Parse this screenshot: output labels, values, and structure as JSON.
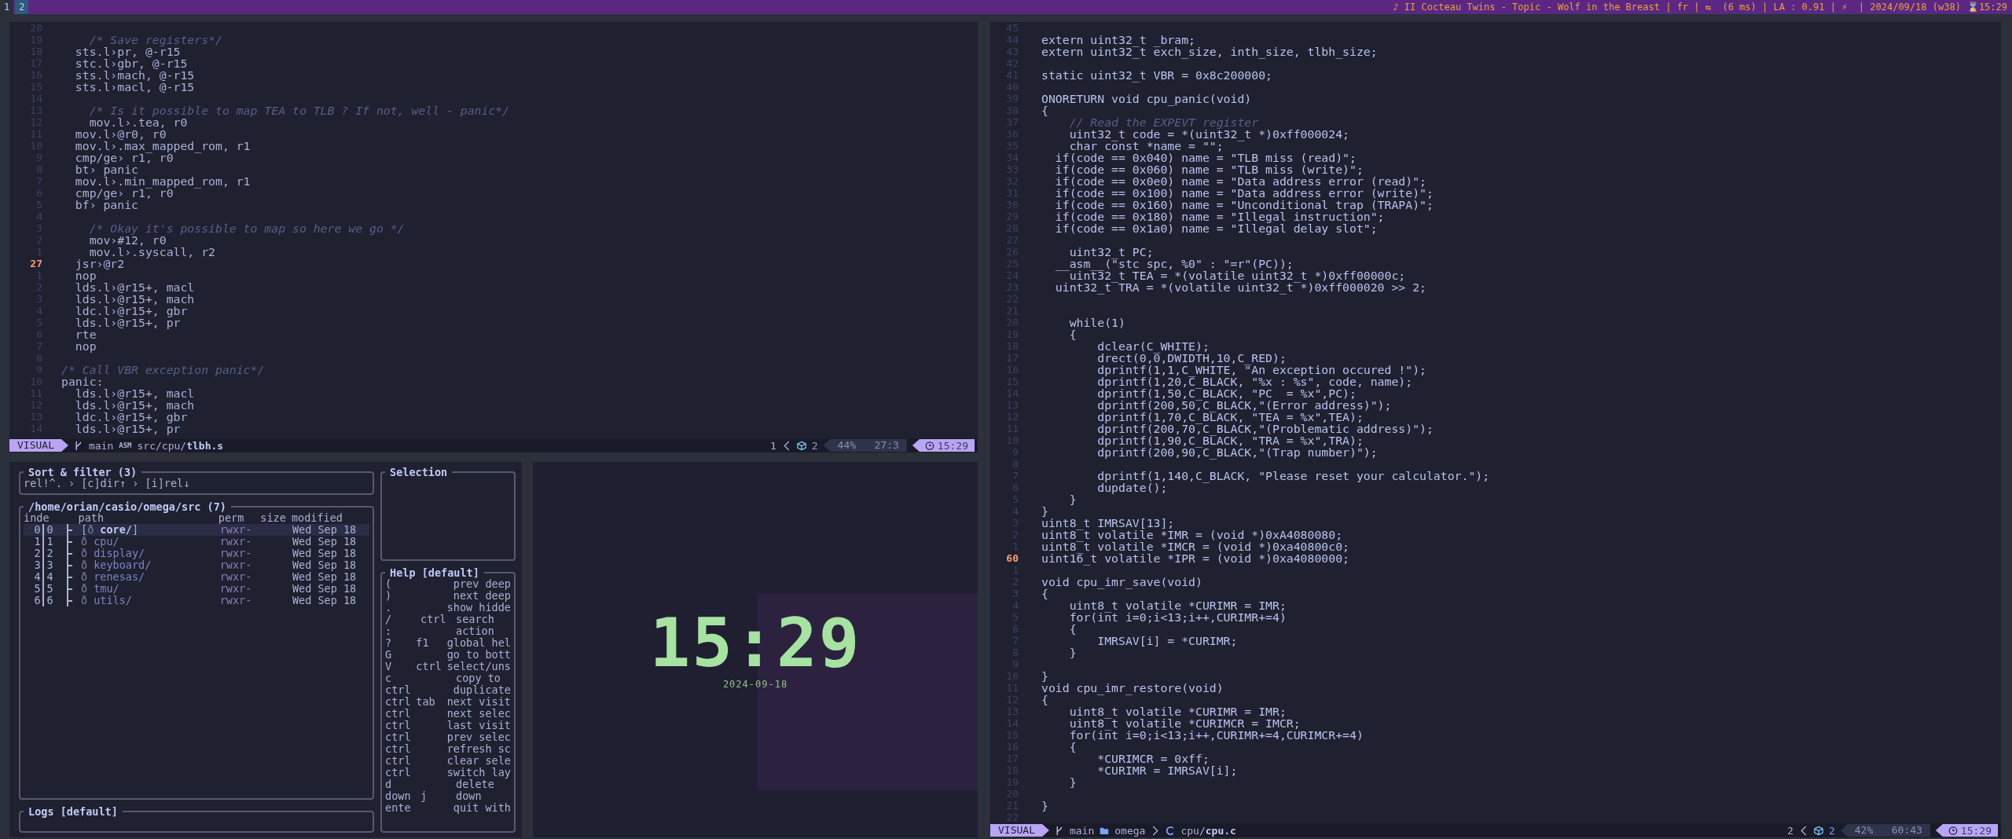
{
  "top_bar": {
    "workspaces": [
      {
        "label": "1",
        "selected": false
      },
      {
        "label": "2",
        "selected": true
      }
    ],
    "status": "♪ II Cocteau Twins - Topic - Wolf in the Breast | fr | ⇆  (6 ms) | LA : 0.91 | ⚡  | 2024/09/18 (w38)",
    "clock": "⌛15:29"
  },
  "left_editor": {
    "lines": [
      {
        "n": "20",
        "current": false
      },
      {
        "n": "19",
        "text": "    /* Save registers*/",
        "kind": "comment",
        "current": false
      },
      {
        "n": "18",
        "text": "  sts.l›pr, @-r15",
        "kind": "code",
        "current": false
      },
      {
        "n": "17",
        "text": "  stc.l›gbr, @-r15",
        "kind": "code",
        "current": false
      },
      {
        "n": "16",
        "text": "  sts.l›mach, @-r15",
        "kind": "code",
        "current": false
      },
      {
        "n": "15",
        "text": "  sts.l›macl, @-r15",
        "kind": "code",
        "current": false
      },
      {
        "n": "14",
        "current": false
      },
      {
        "n": "13",
        "text": "    /* Is it possible to map TEA to TLB ? If not, well - panic*/",
        "kind": "comment",
        "current": false
      },
      {
        "n": "12",
        "text": "    mov.l›.tea, r0",
        "kind": "code",
        "current": false
      },
      {
        "n": "11",
        "text": "  mov.l›@r0, r0",
        "kind": "code",
        "current": false
      },
      {
        "n": "10",
        "text": "  mov.l›.max_mapped_rom, r1",
        "kind": "code",
        "current": false
      },
      {
        "n": "9",
        "text": "  cmp/ge› r1, r0",
        "kind": "code",
        "current": false
      },
      {
        "n": "8",
        "text": "  bt› panic",
        "kind": "code",
        "current": false
      },
      {
        "n": "7",
        "text": "  mov.l›.min_mapped_rom, r1",
        "kind": "code",
        "current": false
      },
      {
        "n": "6",
        "text": "  cmp/ge› r1, r0",
        "kind": "code",
        "current": false
      },
      {
        "n": "5",
        "text": "  bf› panic",
        "kind": "code",
        "current": false
      },
      {
        "n": "4",
        "current": false
      },
      {
        "n": "3",
        "text": "    /* Okay it's possible to map so here we go */",
        "kind": "comment",
        "current": false
      },
      {
        "n": "2",
        "text": "    mov›#12, r0",
        "kind": "code",
        "current": false
      },
      {
        "n": "1",
        "text": "    mov.l›.syscall, r2",
        "kind": "code",
        "current": false
      },
      {
        "n": "27",
        "text": "  jsr›@r2",
        "kind": "code",
        "current": true
      },
      {
        "n": "1",
        "text": "  nop",
        "kind": "code",
        "current": false
      },
      {
        "n": "2",
        "text": "  lds.l›@r15+, macl",
        "kind": "code",
        "current": false
      },
      {
        "n": "3",
        "text": "  lds.l›@r15+, mach",
        "kind": "code",
        "current": false
      },
      {
        "n": "4",
        "text": "  ldc.l›@r15+, gbr",
        "kind": "code",
        "current": false
      },
      {
        "n": "5",
        "text": "  lds.l›@r15+, pr",
        "kind": "code",
        "current": false
      },
      {
        "n": "6",
        "text": "  rte",
        "kind": "code",
        "current": false
      },
      {
        "n": "7",
        "text": "  nop",
        "kind": "code",
        "current": false
      },
      {
        "n": "8",
        "current": false
      },
      {
        "n": "9",
        "text": "/* Call VBR exception panic*/",
        "kind": "comment",
        "current": false
      },
      {
        "n": "10",
        "text": "panic:",
        "kind": "code",
        "current": false
      },
      {
        "n": "11",
        "text": "  lds.l›@r15+, macl",
        "kind": "code",
        "current": false
      },
      {
        "n": "12",
        "text": "  lds.l›@r15+, mach",
        "kind": "code",
        "current": false
      },
      {
        "n": "13",
        "text": "  ldc.l›@r15+, gbr",
        "kind": "code",
        "current": false
      },
      {
        "n": "14",
        "text": "  lds.l›@r15+, pr",
        "kind": "code",
        "current": false
      }
    ],
    "status_bar": {
      "kind": "asm",
      "mode": "VISUAL",
      "branch": "main",
      "filetype": "ASM",
      "path_dir": "src/cpu/",
      "file": "tlbh.s",
      "buffer": "1",
      "count": "2",
      "percent": "44%",
      "position": "27:3",
      "time": "15:29"
    }
  },
  "file_manager": {
    "sort_filter": {
      "title": "Sort & filter (3)",
      "value": "rel!^. › [c]dir↑ › [i]rel↓"
    },
    "directory": {
      "title": "/home/orian/casio/omega/src (7)",
      "columns": [
        "inde",
        "path",
        "perm",
        "size",
        "modified"
      ],
      "rows": [
        {
          "index": "0",
          "rel_index": "0",
          "icon": "ð",
          "name": "core/",
          "open": "[",
          "close": "]",
          "perm": "rwxr-",
          "modified": "Wed Sep 18",
          "selected": true
        },
        {
          "index": "1",
          "rel_index": "1",
          "icon": "ð",
          "name": "cpu/",
          "perm": "rwxr-",
          "modified": "Wed Sep 18",
          "selected": false
        },
        {
          "index": "2",
          "rel_index": "2",
          "icon": "ð",
          "name": "display/",
          "perm": "rwxr-",
          "modified": "Wed Sep 18",
          "selected": false
        },
        {
          "index": "3",
          "rel_index": "3",
          "icon": "ð",
          "name": "keyboard/",
          "perm": "rwxr-",
          "modified": "Wed Sep 18",
          "selected": false
        },
        {
          "index": "4",
          "rel_index": "4",
          "icon": "ð",
          "name": "renesas/",
          "perm": "rwxr-",
          "modified": "Wed Sep 18",
          "selected": false
        },
        {
          "index": "5",
          "rel_index": "5",
          "icon": "ð",
          "name": "tmu/",
          "perm": "rwxr-",
          "modified": "Wed Sep 18",
          "selected": false
        },
        {
          "index": "6",
          "rel_index": "6",
          "icon": "ð",
          "name": "utils/",
          "perm": "rwxr-",
          "modified": "Wed Sep 18",
          "selected": false
        }
      ]
    },
    "logs": {
      "title": "Logs [default]"
    },
    "selection": {
      "title": "Selection"
    },
    "help": {
      "title": "Help [default]",
      "rows": [
        {
          "key": "(",
          "action": "prev deep"
        },
        {
          "key": ")",
          "action": "next deep"
        },
        {
          "key": ".",
          "action": "show hidde"
        },
        {
          "key": "/",
          "mod": "ctrl",
          "action": "search"
        },
        {
          "key": ":",
          "action": "action"
        },
        {
          "key": "?",
          "mod": "f1",
          "action": "global hel"
        },
        {
          "key": "G",
          "action": "go to bott"
        },
        {
          "key": "V",
          "mod": "ctrl",
          "action": "select/uns"
        },
        {
          "key": "c",
          "action": "copy to"
        },
        {
          "key": "ctrl",
          "action": "duplicate"
        },
        {
          "key": "ctrl",
          "mod": "tab",
          "action": "next visit"
        },
        {
          "key": "ctrl",
          "action": "next selec"
        },
        {
          "key": "ctrl",
          "action": "last visit"
        },
        {
          "key": "ctrl",
          "action": "prev selec"
        },
        {
          "key": "ctrl",
          "action": "refresh sc"
        },
        {
          "key": "ctrl",
          "action": "clear sele"
        },
        {
          "key": "ctrl",
          "action": "switch lay"
        },
        {
          "key": "d",
          "action": "delete"
        },
        {
          "key": "down",
          "mod": "j",
          "action": "down"
        },
        {
          "key": "ente",
          "action": "quit with"
        }
      ]
    }
  },
  "clock": {
    "time": "15:29",
    "date": "2024-09-18"
  },
  "right_editor": {
    "lines": [
      {
        "n": "45",
        "current": false
      },
      {
        "n": "44",
        "text": "extern uint32_t _bram;",
        "kind": "code",
        "current": false
      },
      {
        "n": "43",
        "text": "extern uint32_t exch_size, inth_size, tlbh_size;",
        "kind": "code",
        "current": false
      },
      {
        "n": "42",
        "current": false
      },
      {
        "n": "41",
        "text": "static uint32_t VBR = 0x8c200000;",
        "kind": "code",
        "current": false
      },
      {
        "n": "40",
        "current": false
      },
      {
        "n": "39",
        "text": "ONORETURN void cpu_panic(void)",
        "kind": "code",
        "current": false
      },
      {
        "n": "38",
        "text": "{",
        "kind": "code",
        "current": false
      },
      {
        "n": "37",
        "text": "    // Read the EXPEVT register",
        "kind": "comment",
        "current": false
      },
      {
        "n": "36",
        "text": "    uint32_t code = *(uint32_t *)0xff000024;",
        "kind": "code",
        "current": false
      },
      {
        "n": "35",
        "text": "    char const *name = \"\";",
        "kind": "code",
        "current": false
      },
      {
        "n": "34",
        "text": "  if(code == 0x040) name = \"TLB miss (read)\";",
        "kind": "code",
        "current": false
      },
      {
        "n": "33",
        "text": "  if(code == 0x060) name = \"TLB miss (write)\";",
        "kind": "code",
        "current": false
      },
      {
        "n": "32",
        "text": "  if(code == 0x0e0) name = \"Data address error (read)\";",
        "kind": "code",
        "current": false
      },
      {
        "n": "31",
        "text": "  if(code == 0x100) name = \"Data address error (write)\";",
        "kind": "code",
        "current": false
      },
      {
        "n": "30",
        "text": "  if(code == 0x160) name = \"Unconditional trap (TRAPA)\";",
        "kind": "code",
        "current": false
      },
      {
        "n": "29",
        "text": "  if(code == 0x180) name = \"Illegal instruction\";",
        "kind": "code",
        "current": false
      },
      {
        "n": "28",
        "text": "  if(code == 0x1a0) name = \"Illegal delay slot\";",
        "kind": "code",
        "current": false
      },
      {
        "n": "27",
        "current": false
      },
      {
        "n": "26",
        "text": "    uint32_t PC;",
        "kind": "code",
        "current": false
      },
      {
        "n": "25",
        "text": "  __asm__(\"stc spc, %0\" : \"=r\"(PC));",
        "kind": "code",
        "current": false
      },
      {
        "n": "24",
        "text": "    uint32_t TEA = *(volatile uint32_t *)0xff00000c;",
        "kind": "code",
        "current": false
      },
      {
        "n": "23",
        "text": "  uint32_t TRA = *(volatile uint32_t *)0xff000020 >> 2;",
        "kind": "code",
        "current": false
      },
      {
        "n": "22",
        "current": false
      },
      {
        "n": "21",
        "current": false
      },
      {
        "n": "20",
        "text": "    while(1)",
        "kind": "code",
        "current": false
      },
      {
        "n": "19",
        "text": "    {",
        "kind": "code",
        "current": false
      },
      {
        "n": "18",
        "text": "        dclear(C_WHITE);",
        "kind": "code",
        "current": false
      },
      {
        "n": "17",
        "text": "        drect(0,0,DWIDTH,10,C_RED);",
        "kind": "code",
        "current": false
      },
      {
        "n": "16",
        "text": "        dprintf(1,1,C_WHITE, \"An exception occured !\");",
        "kind": "code",
        "current": false
      },
      {
        "n": "15",
        "text": "        dprintf(1,20,C_BLACK, \"%x : %s\", code, name);",
        "kind": "code",
        "current": false
      },
      {
        "n": "14",
        "text": "        dprintf(1,50,C_BLACK, \"PC  = %x\",PC);",
        "kind": "code",
        "current": false
      },
      {
        "n": "13",
        "text": "        dprintf(200,50,C_BLACK,\"(Error address)\");",
        "kind": "code",
        "current": false
      },
      {
        "n": "12",
        "text": "        dprintf(1,70,C_BLACK, \"TEA = %x\",TEA);",
        "kind": "code",
        "current": false
      },
      {
        "n": "11",
        "text": "        dprintf(200,70,C_BLACK,\"(Problematic address)\");",
        "kind": "code",
        "current": false
      },
      {
        "n": "10",
        "text": "        dprintf(1,90,C_BLACK, \"TRA = %x\",TRA);",
        "kind": "code",
        "current": false
      },
      {
        "n": "9",
        "text": "        dprintf(200,90,C_BLACK,\"(Trap number)\");",
        "kind": "code",
        "current": false
      },
      {
        "n": "8",
        "current": false
      },
      {
        "n": "7",
        "text": "        dprintf(1,140,C_BLACK, \"Please reset your calculator.\");",
        "kind": "code",
        "current": false
      },
      {
        "n": "6",
        "text": "        dupdate();",
        "kind": "code",
        "current": false
      },
      {
        "n": "5",
        "text": "    }",
        "kind": "code",
        "current": false
      },
      {
        "n": "4",
        "text": "}",
        "kind": "code",
        "current": false
      },
      {
        "n": "3",
        "text": "uint8_t IMRSAV[13];",
        "kind": "code",
        "current": false
      },
      {
        "n": "2",
        "text": "uint8_t volatile *IMR = (void *)0xA4080080;",
        "kind": "code",
        "current": false
      },
      {
        "n": "1",
        "text": "uint8_t volatile *IMCR = (void *)0xa40800c0;",
        "kind": "code",
        "current": false
      },
      {
        "n": "60",
        "text": "uint16_t volatile *IPR = (void *)0xa4080000;",
        "kind": "code",
        "current": true
      },
      {
        "n": "1",
        "current": false
      },
      {
        "n": "2",
        "text": "void cpu_imr_save(void)",
        "kind": "code",
        "current": false
      },
      {
        "n": "3",
        "text": "{",
        "kind": "code",
        "current": false
      },
      {
        "n": "4",
        "text": "    uint8_t volatile *CURIMR = IMR;",
        "kind": "code",
        "current": false
      },
      {
        "n": "5",
        "text": "    for(int i=0;i<13;i++,CURIMR+=4)",
        "kind": "code",
        "current": false
      },
      {
        "n": "6",
        "text": "    {",
        "kind": "code",
        "current": false
      },
      {
        "n": "7",
        "text": "        IMRSAV[i] = *CURIMR;",
        "kind": "code",
        "current": false
      },
      {
        "n": "8",
        "text": "    }",
        "kind": "code",
        "current": false
      },
      {
        "n": "9",
        "current": false
      },
      {
        "n": "10",
        "text": "}",
        "kind": "code",
        "current": false
      },
      {
        "n": "11",
        "text": "void cpu_imr_restore(void)",
        "kind": "code",
        "current": false
      },
      {
        "n": "12",
        "text": "{",
        "kind": "code",
        "current": false
      },
      {
        "n": "13",
        "text": "    uint8_t volatile *CURIMR = IMR;",
        "kind": "code",
        "current": false
      },
      {
        "n": "14",
        "text": "    uint8_t volatile *CURIMCR = IMCR;",
        "kind": "code",
        "current": false
      },
      {
        "n": "15",
        "text": "    for(int i=0;i<13;i++,CURIMR+=4,CURIMCR+=4)",
        "kind": "code",
        "current": false
      },
      {
        "n": "16",
        "text": "    {",
        "kind": "code",
        "current": false
      },
      {
        "n": "17",
        "text": "        *CURIMCR = 0xff;",
        "kind": "code",
        "current": false
      },
      {
        "n": "18",
        "text": "        *CURIMR = IMRSAV[i];",
        "kind": "code",
        "current": false
      },
      {
        "n": "19",
        "text": "    }",
        "kind": "code",
        "current": false
      },
      {
        "n": "20",
        "current": false
      },
      {
        "n": "21",
        "text": "}",
        "kind": "code",
        "current": false
      },
      {
        "n": "22",
        "current": false
      }
    ],
    "status_bar": {
      "kind": "c",
      "mode": "VISUAL",
      "branch": "main",
      "project": "omega",
      "path_dir": "cpu/",
      "file": "cpu.c",
      "buffer": "2",
      "count": "2",
      "percent": "42%",
      "position": "60:43",
      "time": "15:29"
    }
  }
}
